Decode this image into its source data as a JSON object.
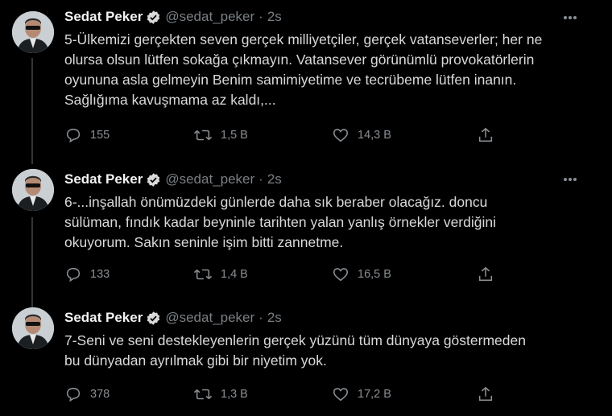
{
  "author": {
    "name": "Sedat Peker",
    "handle": "@sedat_peker",
    "separator": "·",
    "verified": true
  },
  "icons": {
    "verified": "verified-badge-icon",
    "more": "more-dots-icon",
    "reply": "reply-icon",
    "retweet": "retweet-icon",
    "like": "heart-icon",
    "share": "share-icon"
  },
  "colors": {
    "background": "#000000",
    "text": "#d9d9d9",
    "muted": "#7a7f84",
    "verified": "#d9d9d9"
  },
  "tweets": [
    {
      "time": "2s",
      "text": "5-Ülkemizi gerçekten seven gerçek milliyetçiler, gerçek vatanseverler; her ne\nolursa olsun lütfen sokağa çıkmayın. Vatansever görünümlü provokatörlerin\noyununa asla gelmeyin  Benim samimiyetime ve tecrübeme lütfen inanın.\nSağlığıma kavuşmama az kaldı,...",
      "replies": "155",
      "retweets": "1,5 B",
      "likes": "14,3 B"
    },
    {
      "time": "2s",
      "text": "6-...inşallah önümüzdeki günlerde daha sık beraber olacağız. doncu\nsülüman, fındık kadar beyninle tarihten yalan yanlış örnekler verdiğini\nokuyorum. Sakın seninle işim bitti zannetme.",
      "replies": "133",
      "retweets": "1,4 B",
      "likes": "16,5 B"
    },
    {
      "time": "2s",
      "text": "7-Seni ve seni destekleyenlerin gerçek yüzünü tüm dünyaya göstermeden\nbu dünyadan ayrılmak gibi bir niyetim yok.",
      "replies": "378",
      "retweets": "1,3 B",
      "likes": "17,2 B"
    }
  ]
}
